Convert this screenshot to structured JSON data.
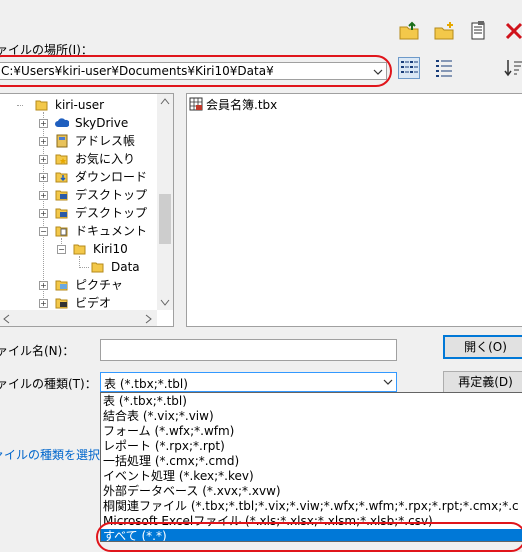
{
  "location": {
    "label": "ァイルの場所(I)：",
    "value": "C:¥Users¥kiri-user¥Documents¥Kiri10¥Data¥"
  },
  "toolbar": {
    "icons": [
      "up-folder-icon",
      "new-folder-icon",
      "properties-icon",
      "delete-icon",
      "list-view-icon",
      "details-view-icon",
      "sort-icon"
    ]
  },
  "tree": {
    "items": [
      {
        "label": "kiri-user",
        "icon": "folder-open-icon"
      },
      {
        "label": "SkyDrive",
        "icon": "cloud-icon"
      },
      {
        "label": "アドレス帳",
        "icon": "address-book-icon"
      },
      {
        "label": "お気に入り",
        "icon": "favorites-icon"
      },
      {
        "label": "ダウンロード",
        "icon": "download-icon"
      },
      {
        "label": "デスクトップ",
        "icon": "desktop-icon"
      },
      {
        "label": "デスクトップ",
        "icon": "desktop-icon"
      },
      {
        "label": "ドキュメント",
        "icon": "documents-icon"
      },
      {
        "label": "Kiri10",
        "icon": "folder-open-icon"
      },
      {
        "label": "Data",
        "icon": "folder-icon"
      },
      {
        "label": "ピクチャ",
        "icon": "pictures-icon"
      },
      {
        "label": "ビデオ",
        "icon": "videos-icon"
      }
    ]
  },
  "files": [
    {
      "name": "会員名簿.tbx",
      "icon": "tbx-file-icon"
    }
  ],
  "filename": {
    "label": "ァイル名(N)：",
    "value": "",
    "open_button": "開く(O)"
  },
  "filetype": {
    "label": "ァイルの種類(T)：",
    "selected": "表 (*.tbx;*.tbl)",
    "redefine_button": "再定義(D)",
    "options": [
      "表 (*.tbx;*.tbl)",
      "結合表 (*.vix;*.viw)",
      "フォーム (*.wfx;*.wfm)",
      "レポート (*.rpx;*.rpt)",
      "一括処理 (*.cmx;*.cmd)",
      "イベント処理 (*.kex;*.kev)",
      "外部データベース (*.xvx;*.xvw)",
      "桐関連ファイル (*.tbx;*.tbl;*.vix;*.viw;*.wfx;*.wfm;*.rpx;*.rpt;*.cmx;*.c",
      "Microsoft Excelファイル (*.xls;*.xlsx;*.xlsm;*.xlsb;*.csv)",
      "すべて (*.*)"
    ]
  },
  "hint": "ァイルの種類を選択し",
  "colors": {
    "accent": "#0078d7",
    "highlight_ring": "#e0151b",
    "link": "#0066cc"
  }
}
